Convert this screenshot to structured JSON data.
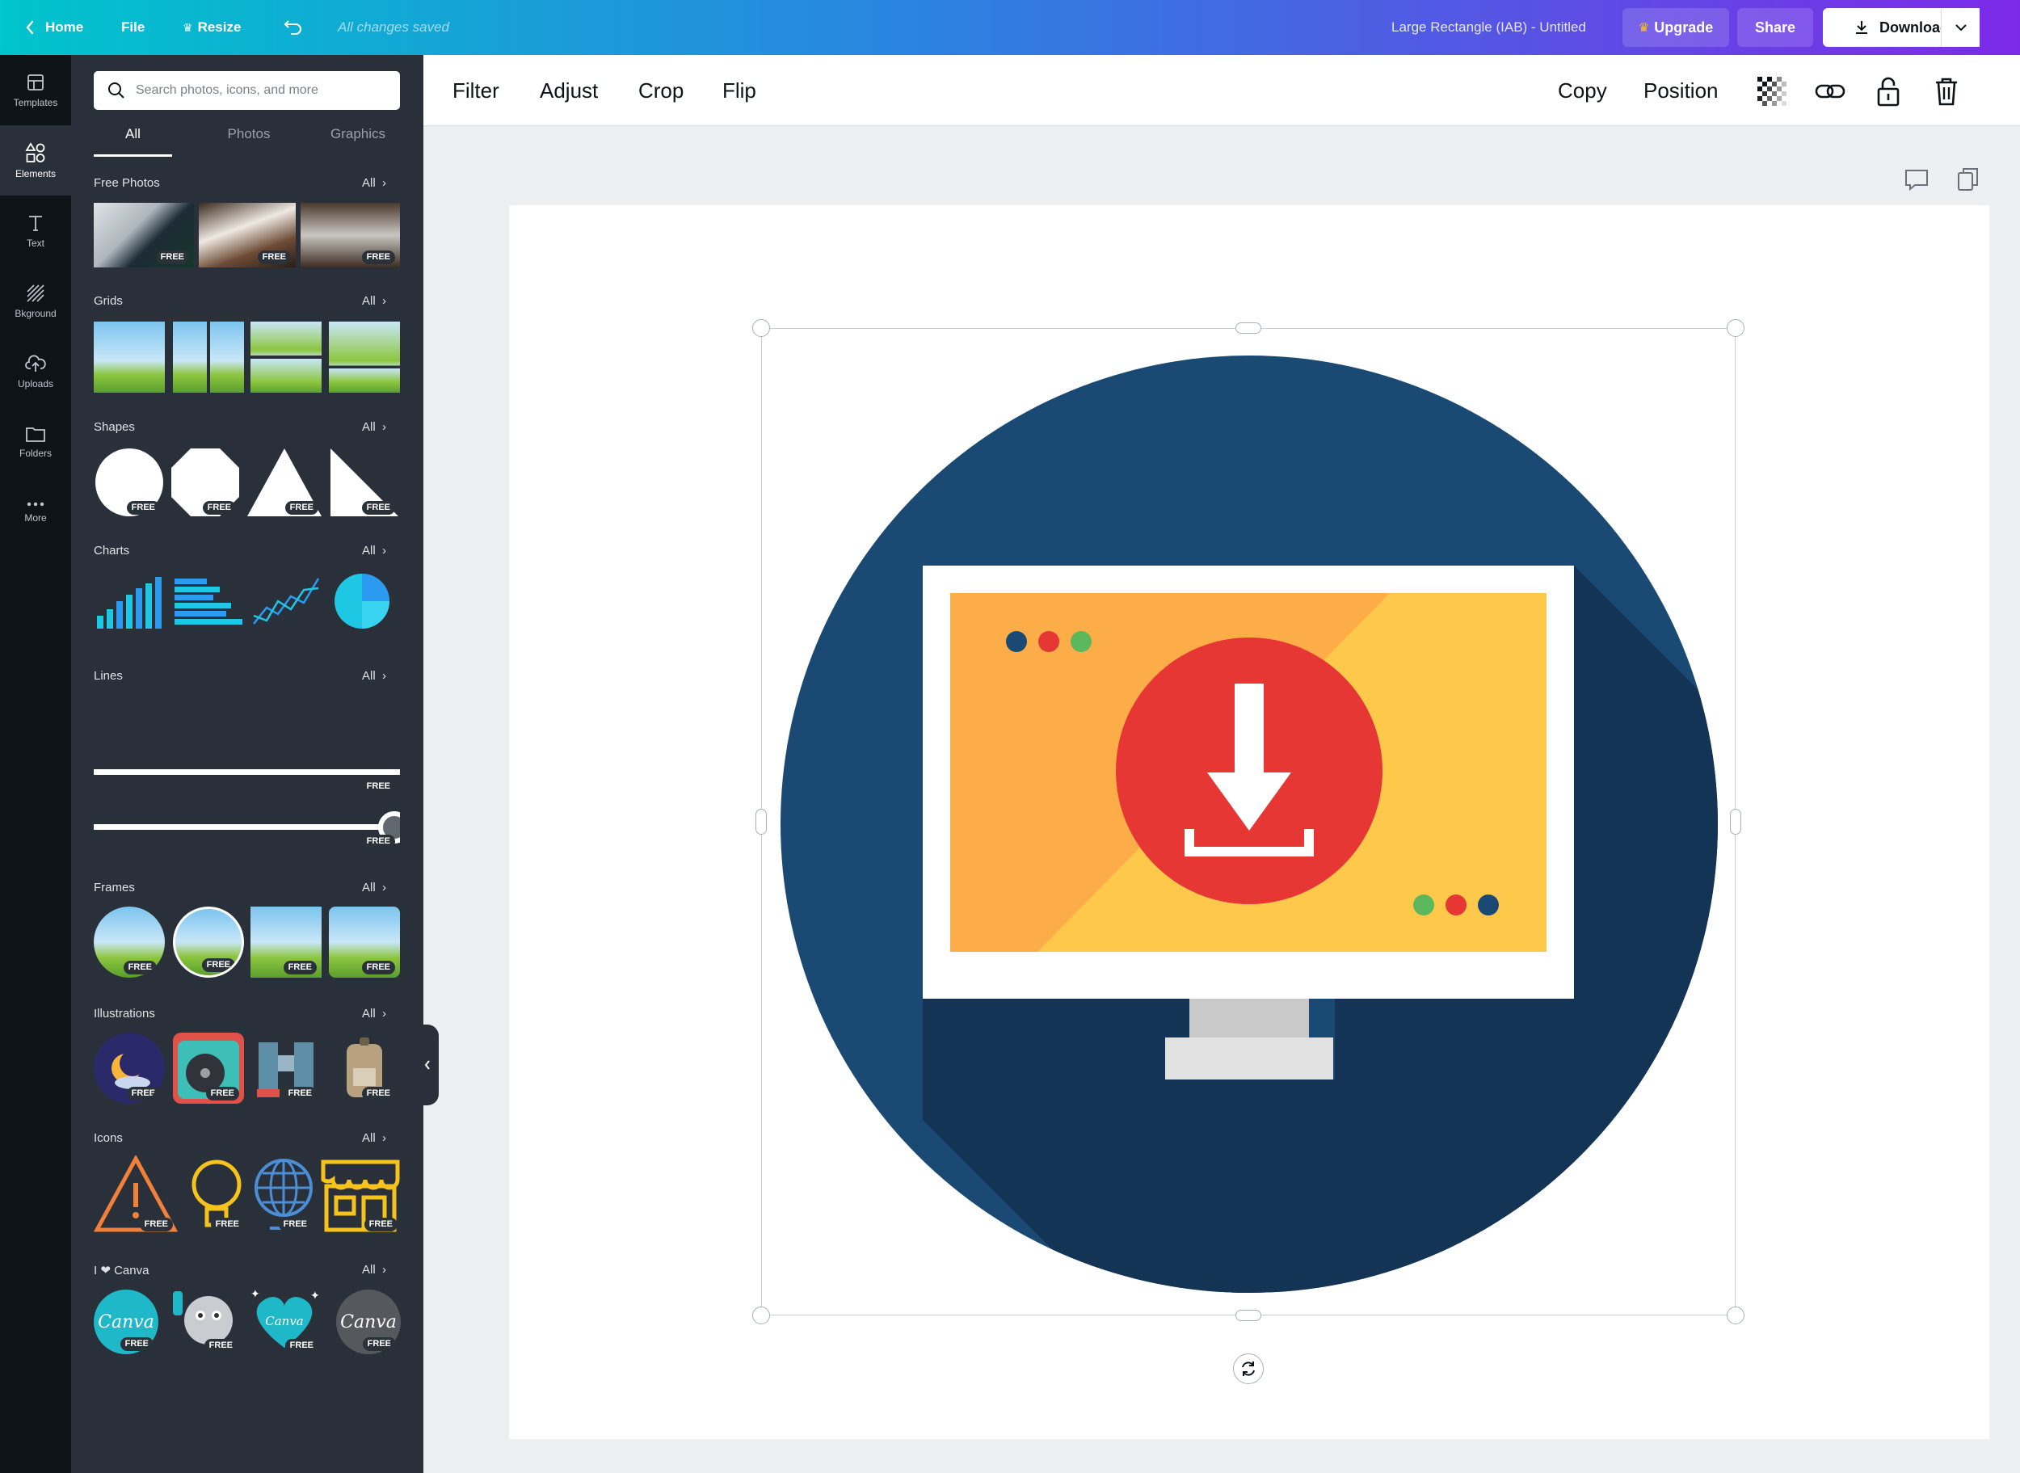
{
  "topbar": {
    "home": "Home",
    "file": "File",
    "resize": "Resize",
    "saved_status": "All changes saved",
    "doc_title": "Large Rectangle (IAB) - Untitled",
    "upgrade": "Upgrade",
    "share": "Share",
    "download": "Download"
  },
  "rail": {
    "items": [
      {
        "label": "Templates",
        "icon": "templates-icon"
      },
      {
        "label": "Elements",
        "icon": "elements-icon",
        "active": true
      },
      {
        "label": "Text",
        "icon": "text-icon"
      },
      {
        "label": "Bkground",
        "icon": "background-icon"
      },
      {
        "label": "Uploads",
        "icon": "upload-icon"
      },
      {
        "label": "Folders",
        "icon": "folder-icon"
      },
      {
        "label": "More",
        "icon": "more-icon"
      }
    ]
  },
  "panel": {
    "search_placeholder": "Search photos, icons, and more",
    "tabs": [
      "All",
      "Photos",
      "Graphics"
    ],
    "all_label": "All",
    "free_badge": "FREE",
    "sections": {
      "free_photos": "Free Photos",
      "grids": "Grids",
      "shapes": "Shapes",
      "charts": "Charts",
      "lines": "Lines",
      "frames": "Frames",
      "illustrations": "Illustrations",
      "icons": "Icons",
      "canva": "I ❤ Canva"
    },
    "canva_sticker_text": "Canva"
  },
  "toolbar": {
    "filter": "Filter",
    "adjust": "Adjust",
    "crop": "Crop",
    "flip": "Flip",
    "copy": "Copy",
    "position": "Position"
  },
  "colors": {
    "accent_teal": "#00c4cc",
    "accent_purple": "#7d2ae8",
    "circle_blue": "#1a4a73",
    "shadow_blue": "#133455",
    "screen_orange": "#fdad48",
    "screen_yellow": "#fec84a",
    "download_red": "#e73735",
    "dot_green": "#5cb85c"
  }
}
